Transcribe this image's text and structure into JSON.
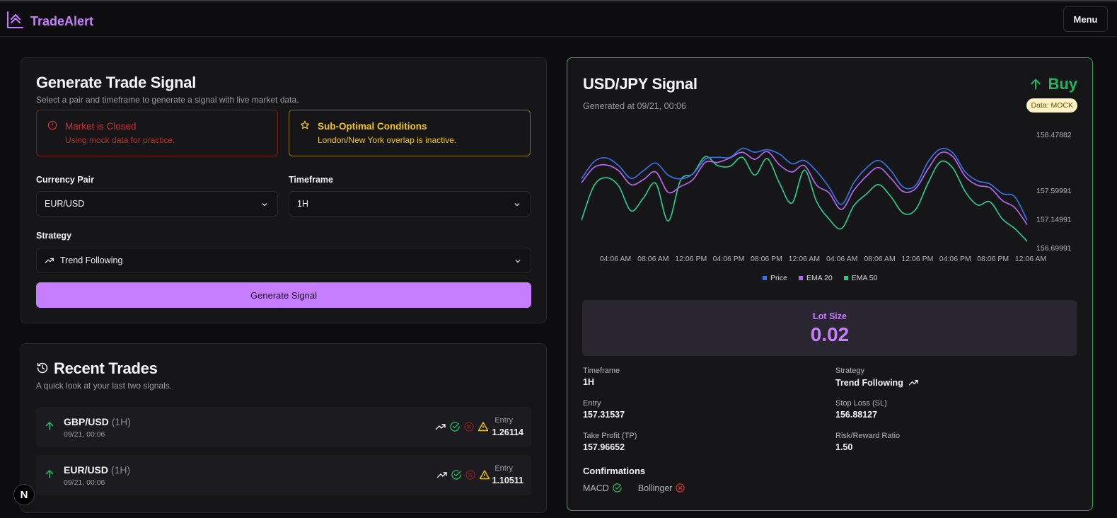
{
  "app": {
    "name": "TradeAlert",
    "menu_label": "Menu"
  },
  "generator": {
    "title": "Generate Trade Signal",
    "subtitle": "Select a pair and timeframe to generate a signal with live market data.",
    "alerts": [
      {
        "title": "Market is Closed",
        "body": "Using mock data for practice.",
        "color": "#c53333"
      },
      {
        "title": "Sub-Optimal Conditions",
        "body": "London/New York overlap is inactive.",
        "color": "#f0c419"
      }
    ],
    "currency_pair": {
      "label": "Currency Pair",
      "value": "EUR/USD"
    },
    "timeframe": {
      "label": "Timeframe",
      "value": "1H"
    },
    "strategy": {
      "label": "Strategy",
      "value": "Trend Following"
    },
    "button_label": "Generate Signal"
  },
  "recent": {
    "title": "Recent Trades",
    "subtitle": "A quick look at your last two signals.",
    "entry_label": "Entry",
    "trades": [
      {
        "pair": "GBP/USD",
        "tf": "(1H)",
        "time": "09/21, 00:06",
        "entry": "1.26114",
        "direction": "up"
      },
      {
        "pair": "EUR/USD",
        "tf": "(1H)",
        "time": "09/21, 00:06",
        "entry": "1.10511",
        "direction": "up"
      }
    ]
  },
  "signal": {
    "title": "USD/JPY Signal",
    "generated": "Generated at 09/21, 00:06",
    "direction": "Buy",
    "badge": "Data: MOCK",
    "lot_label": "Lot Size",
    "lot_value": "0.02",
    "details": {
      "timeframe": {
        "label": "Timeframe",
        "value": "1H"
      },
      "strategy": {
        "label": "Strategy",
        "value": "Trend Following"
      },
      "entry": {
        "label": "Entry",
        "value": "157.31537"
      },
      "stop_loss": {
        "label": "Stop Loss (SL)",
        "value": "156.88127"
      },
      "take_profit": {
        "label": "Take Profit (TP)",
        "value": "157.96652"
      },
      "rr": {
        "label": "Risk/Reward Ratio",
        "value": "1.50"
      }
    },
    "confirmations_title": "Confirmations",
    "confirmations": [
      {
        "name": "MACD",
        "ok": true
      },
      {
        "name": "Bollinger",
        "ok": false
      }
    ]
  },
  "colors": {
    "accent": "#c77dff",
    "buy": "#22b35e",
    "price": "#3b6fe0",
    "ema20": "#b366e8",
    "ema50": "#2ec68a"
  },
  "chart_data": {
    "type": "line",
    "x_ticks": [
      "04:06 AM",
      "08:06 AM",
      "12:06 PM",
      "04:06 PM",
      "08:06 PM",
      "12:06 AM",
      "04:06 AM",
      "08:06 AM",
      "12:06 PM",
      "04:06 PM",
      "08:06 PM",
      "12:06 AM"
    ],
    "y_ticks": [
      "158.47882",
      "157.59991",
      "157.14991",
      "156.69991"
    ],
    "ylim": [
      156.69991,
      158.47882
    ],
    "legend_position": "bottom",
    "series": [
      {
        "name": "Price",
        "color": "#3b6fe0",
        "values": [
          157.78,
          158.05,
          158.11,
          157.99,
          157.79,
          157.91,
          158.03,
          157.84,
          157.78,
          157.86,
          158.09,
          158.12,
          158.12,
          158.26,
          158.2,
          158.24,
          158.17,
          158.02,
          158.07,
          157.9,
          157.65,
          157.38,
          157.72,
          157.95,
          158.07,
          157.91,
          157.65,
          157.68,
          158.05,
          158.25,
          158.19,
          157.89,
          157.75,
          157.7,
          157.55,
          157.5,
          157.13
        ]
      },
      {
        "name": "EMA 20",
        "color": "#b366e8",
        "values": [
          157.72,
          157.96,
          158.0,
          157.91,
          157.69,
          157.77,
          157.89,
          157.57,
          157.66,
          157.77,
          158.04,
          158.04,
          158.11,
          158.2,
          158.09,
          158.21,
          158.0,
          157.89,
          157.99,
          157.68,
          157.56,
          157.3,
          157.6,
          157.82,
          157.96,
          157.79,
          157.58,
          157.63,
          157.94,
          158.19,
          158.13,
          157.82,
          157.68,
          157.64,
          157.44,
          157.33,
          157.06
        ]
      },
      {
        "name": "EMA 50",
        "color": "#2ec68a",
        "values": [
          157.13,
          157.67,
          157.8,
          157.67,
          157.28,
          157.48,
          157.71,
          157.12,
          157.76,
          157.86,
          158.13,
          157.99,
          157.98,
          158.12,
          157.84,
          158.1,
          157.71,
          157.4,
          157.92,
          157.42,
          157.15,
          157.0,
          157.36,
          157.54,
          157.69,
          157.5,
          157.24,
          157.3,
          157.72,
          158.05,
          157.95,
          157.58,
          157.37,
          157.42,
          157.15,
          157.0,
          156.8
        ]
      }
    ]
  }
}
